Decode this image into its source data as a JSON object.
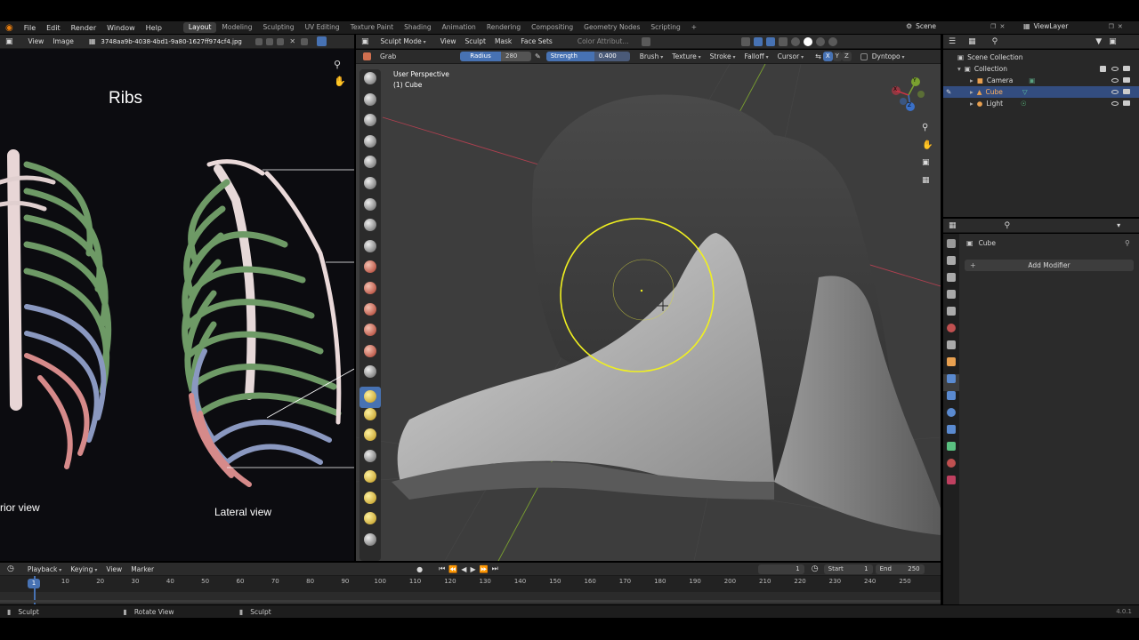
{
  "topbar": {
    "menus": [
      "File",
      "Edit",
      "Render",
      "Window",
      "Help"
    ],
    "workspaces": [
      "Layout",
      "Modeling",
      "Sculpting",
      "UV Editing",
      "Texture Paint",
      "Shading",
      "Animation",
      "Rendering",
      "Compositing",
      "Geometry Nodes",
      "Scripting"
    ],
    "active_workspace": "Layout",
    "add_workspace": "+",
    "scene": "Scene",
    "viewlayer": "ViewLayer"
  },
  "image_editor": {
    "menus": [
      "View",
      "Image"
    ],
    "filename": "3748aa9b-4038-4bd1-9a80-1627ff974cf4.jpg",
    "image": {
      "title": "Ribs",
      "left_caption": "rior view",
      "right_caption": "Lateral view"
    }
  },
  "viewport": {
    "mode": "Sculpt Mode",
    "menus": [
      "View",
      "Sculpt",
      "Mask",
      "Face Sets"
    ],
    "color_attr": "Color Attribut...",
    "brush_name": "Grab",
    "radius_label": "Radius",
    "radius_value": "280 px",
    "strength_label": "Strength",
    "strength_value": "0.400",
    "header_drops": [
      "Brush",
      "Texture",
      "Stroke",
      "Falloff",
      "Cursor"
    ],
    "axes": [
      "X",
      "Y",
      "Z"
    ],
    "dyntopo": "Dyntopo",
    "overlay_title": "User Perspective",
    "overlay_object": "(1) Cube",
    "gizmo": {
      "x": "X",
      "y": "Y",
      "z": "Z"
    }
  },
  "outliner": {
    "root": "Scene Collection",
    "collection": "Collection",
    "items": [
      "Camera",
      "Cube",
      "Light"
    ],
    "selected": "Cube"
  },
  "properties": {
    "object": "Cube",
    "add_modifier": "Add Modifier"
  },
  "timeline": {
    "menus": [
      "Playback",
      "Keying",
      "View",
      "Marker"
    ],
    "current_frame": "1",
    "start_label": "Start",
    "start_value": "1",
    "end_label": "End",
    "end_value": "250",
    "ticks": [
      "1",
      "10",
      "20",
      "30",
      "40",
      "50",
      "60",
      "70",
      "80",
      "90",
      "100",
      "110",
      "120",
      "130",
      "140",
      "150",
      "160",
      "170",
      "180",
      "190",
      "200",
      "210",
      "220",
      "230",
      "240",
      "250"
    ]
  },
  "statusbar": {
    "left": "Sculpt",
    "middle": "Rotate View",
    "right": "Sculpt",
    "version": "4.0.1"
  },
  "colors": {
    "accent": "#4772b3",
    "selection": "#ffff00",
    "axis_x": "#cc3344",
    "axis_y": "#88bb22"
  }
}
